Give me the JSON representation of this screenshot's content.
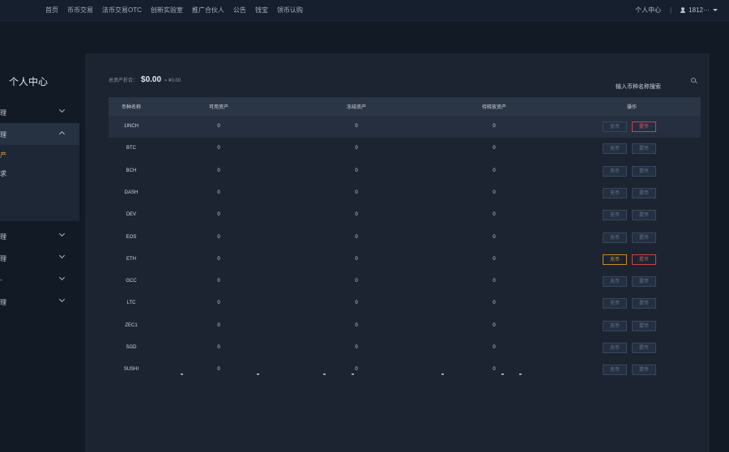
{
  "nav": {
    "items": [
      "首页",
      "币币交易",
      "法币交易OTC",
      "创新实验室",
      "推广合伙人",
      "公告",
      "钱宝",
      "领币认购"
    ]
  },
  "topright": {
    "personal_center": "个人中心",
    "separator": "|",
    "username": "1812···"
  },
  "sidebar": {
    "title": "个人中心",
    "items": [
      {
        "label": "理",
        "expanded": false
      },
      {
        "label": "理",
        "expanded": true
      },
      {
        "label": "理",
        "expanded": false
      },
      {
        "label": "理",
        "expanded": false
      },
      {
        "label": "-",
        "expanded": false
      },
      {
        "label": "理",
        "expanded": false
      }
    ],
    "submenu": [
      {
        "label": "产",
        "active": true
      },
      {
        "label": "求",
        "active": false
      }
    ]
  },
  "summary": {
    "label": "总资产折合：",
    "value": "$0.00",
    "cny": "≈ ¥0.00"
  },
  "search": {
    "placeholder": "输入币种名称搜索"
  },
  "table": {
    "columns": [
      "币种名称",
      "可用资产",
      "冻结资产",
      "待释放资产",
      "操作"
    ],
    "deposit_label": "充币",
    "withdraw_label": "提币",
    "rows": [
      {
        "coin": "1INCH",
        "available": "0",
        "frozen": "0",
        "pending": "0",
        "deposit_enabled": false,
        "withdraw_enabled": true
      },
      {
        "coin": "BTC",
        "available": "0",
        "frozen": "0",
        "pending": "0",
        "deposit_enabled": false,
        "withdraw_enabled": false
      },
      {
        "coin": "BCH",
        "available": "0",
        "frozen": "0",
        "pending": "0",
        "deposit_enabled": false,
        "withdraw_enabled": false
      },
      {
        "coin": "DASH",
        "available": "0",
        "frozen": "0",
        "pending": "0",
        "deposit_enabled": false,
        "withdraw_enabled": false
      },
      {
        "coin": "DEV",
        "available": "0",
        "frozen": "0",
        "pending": "0",
        "deposit_enabled": false,
        "withdraw_enabled": false
      },
      {
        "coin": "EOS",
        "available": "0",
        "frozen": "0",
        "pending": "0",
        "deposit_enabled": false,
        "withdraw_enabled": false
      },
      {
        "coin": "ETH",
        "available": "0",
        "frozen": "0",
        "pending": "0",
        "deposit_enabled": true,
        "withdraw_enabled": true
      },
      {
        "coin": "GCC",
        "available": "0",
        "frozen": "0",
        "pending": "0",
        "deposit_enabled": false,
        "withdraw_enabled": false
      },
      {
        "coin": "LTC",
        "available": "0",
        "frozen": "0",
        "pending": "0",
        "deposit_enabled": false,
        "withdraw_enabled": false
      },
      {
        "coin": "ZEC1",
        "available": "0",
        "frozen": "0",
        "pending": "0",
        "deposit_enabled": false,
        "withdraw_enabled": false
      },
      {
        "coin": "SGD",
        "available": "0",
        "frozen": "0",
        "pending": "0",
        "deposit_enabled": false,
        "withdraw_enabled": false
      },
      {
        "coin": "SUSHI",
        "available": "0",
        "frozen": "0",
        "pending": "0",
        "deposit_enabled": false,
        "withdraw_enabled": false
      }
    ]
  },
  "colors": {
    "background": "#121a26",
    "panel": "#1c2431",
    "accent_orange": "#d39b3a",
    "accent_red": "#d45c63"
  }
}
